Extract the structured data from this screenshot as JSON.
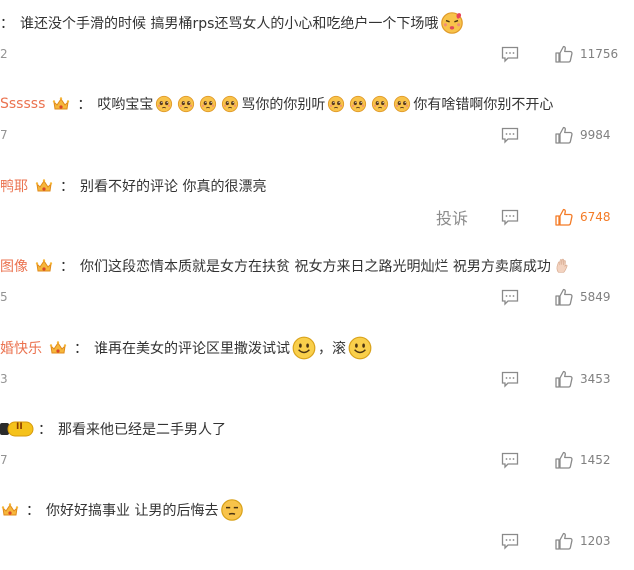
{
  "comments": [
    {
      "user": "",
      "text": "谁还没个手滑的时候 搞男桶rps还骂女人的小心和吃绝户一个下场哦",
      "meta": "2",
      "likes": "11756",
      "liked": false
    },
    {
      "user": "Ssssss",
      "text_a": "哎哟宝宝",
      "text_b": "骂你的你别听",
      "text_c": "你有啥错啊你别不开心",
      "meta": "7",
      "likes": "9984",
      "liked": false
    },
    {
      "user": "鸭耶",
      "text": "别看不好的评论 你真的很漂亮",
      "meta": "",
      "report_label": "投诉",
      "likes": "6748",
      "liked": true
    },
    {
      "user": "图像",
      "text": "你们这段恋情本质就是女方在扶贫 祝女方来日之路光明灿烂 祝男方卖腐成功",
      "meta": "5",
      "likes": "5849",
      "liked": false
    },
    {
      "user": "婚快乐",
      "text_a": "谁再在美女的评论区里撒泼试试",
      "text_b": "，滚",
      "meta": "3",
      "likes": "3453",
      "liked": false
    },
    {
      "user": "",
      "badge": "II",
      "text": "那看来他已经是二手男人了",
      "meta": "7",
      "likes": "1452",
      "liked": false
    },
    {
      "user": "",
      "text": "你好好搞事业 让男的后悔去",
      "meta": "",
      "likes": "1203",
      "liked": false
    }
  ],
  "colors": {
    "username": "#eb7350",
    "liked": "#f47b26",
    "muted": "#808080"
  }
}
